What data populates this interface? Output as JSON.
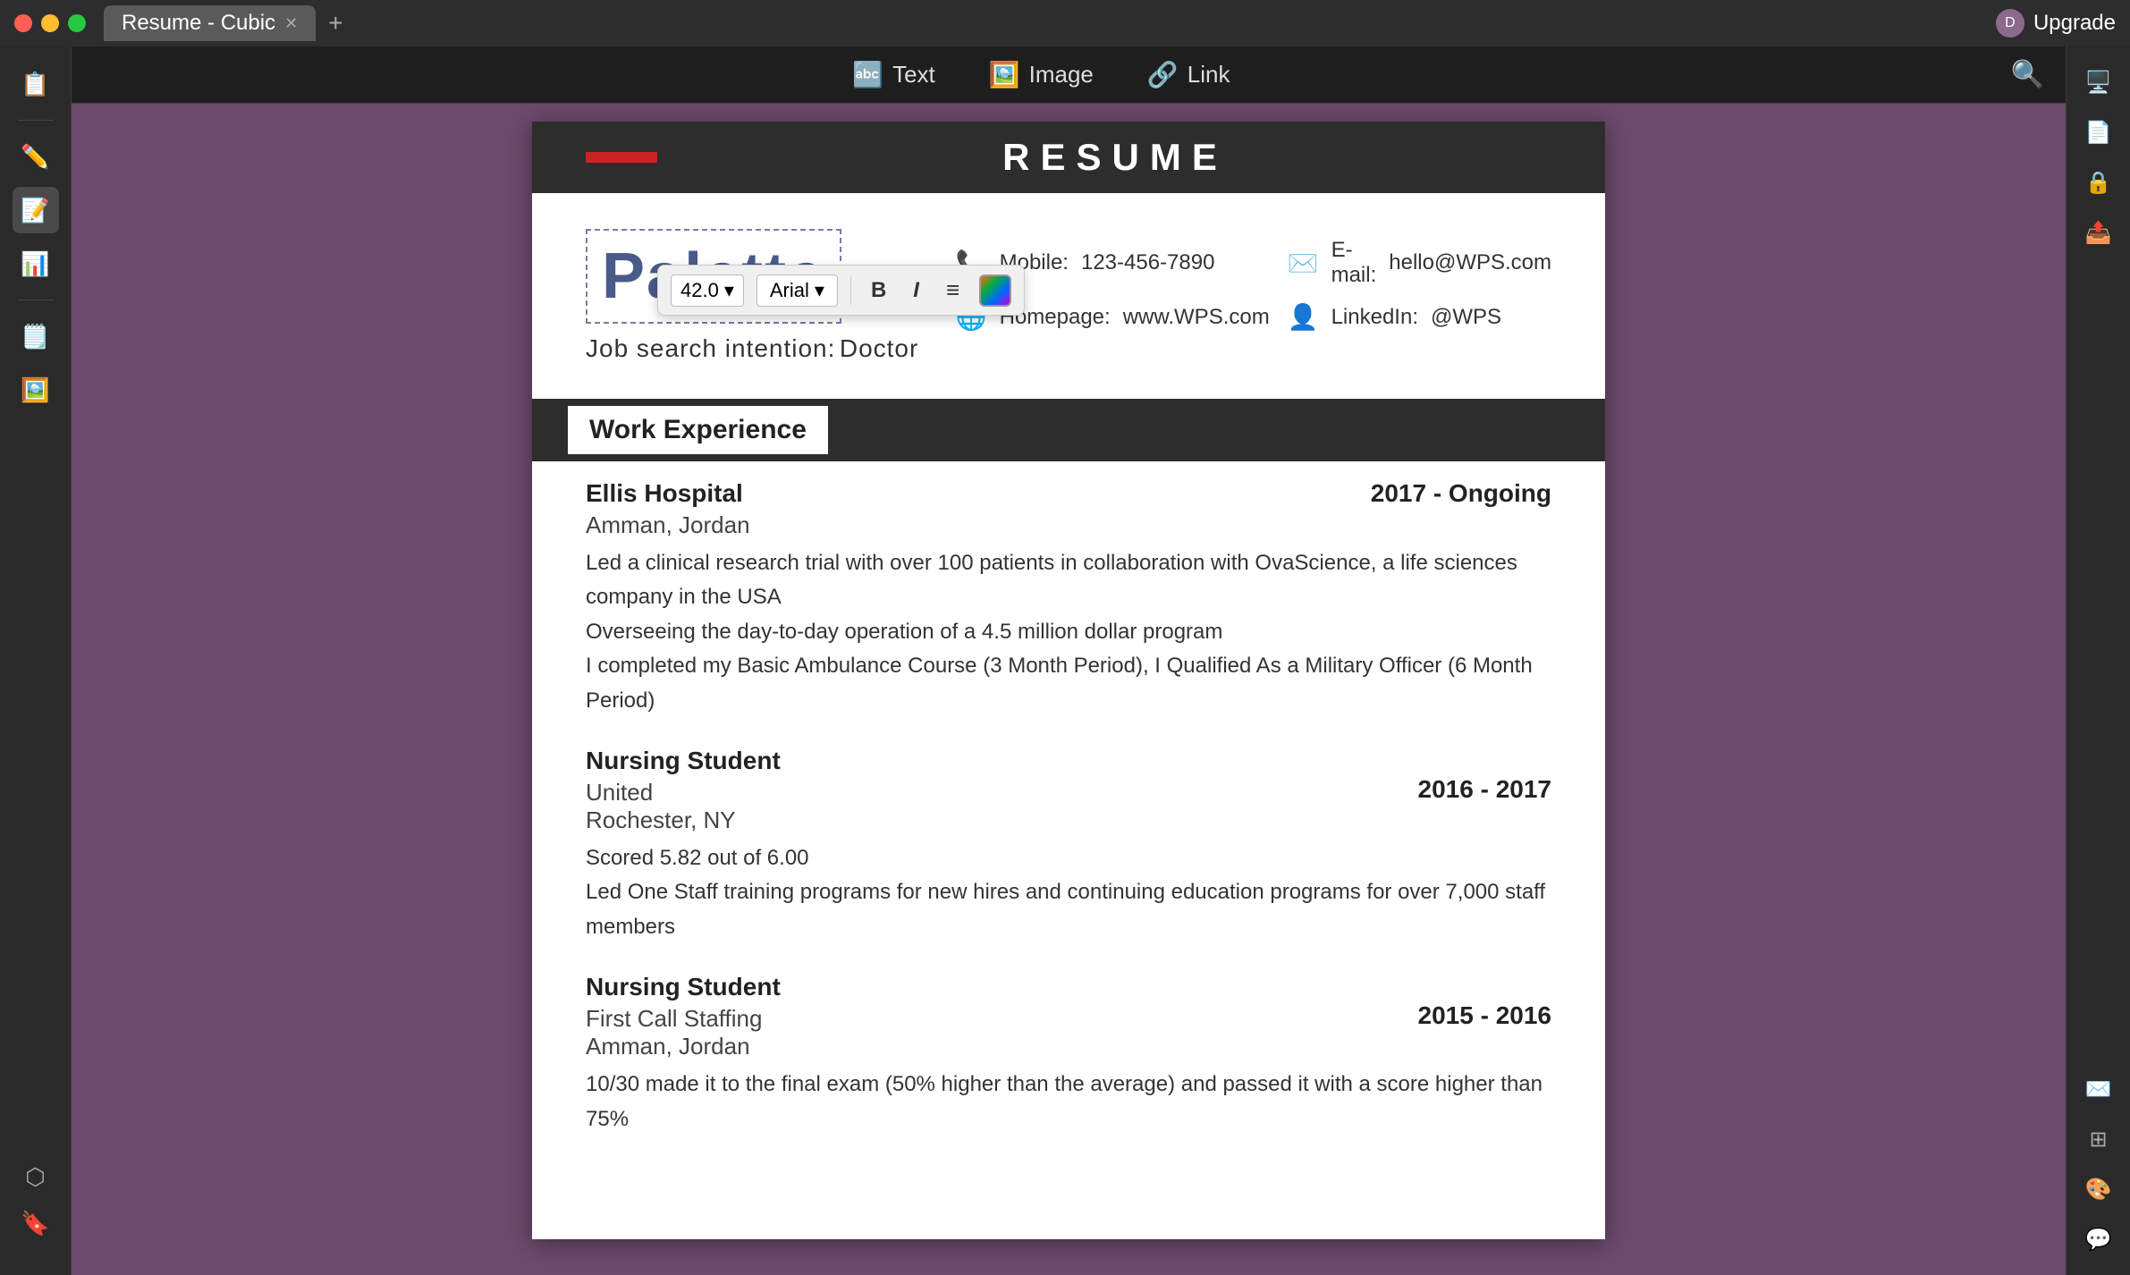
{
  "titlebar": {
    "tab_label": "Resume - Cubic",
    "upgrade_label": "Upgrade",
    "upgrade_avatar": "D"
  },
  "toolbar": {
    "text_label": "Text",
    "image_label": "Image",
    "link_label": "Link"
  },
  "floating_toolbar": {
    "font_size": "42.0",
    "font_name": "Arial",
    "bold_label": "B",
    "italic_label": "I",
    "list_label": "≡"
  },
  "sidebar_left": {
    "icons": [
      "📋",
      "✏️",
      "📝",
      "📊",
      "📋",
      "🖼️"
    ]
  },
  "sidebar_right": {
    "icons": [
      "🖥️",
      "📄",
      "🔒",
      "📤",
      "✉️",
      "🔲",
      "🎨",
      "💬"
    ]
  },
  "resume": {
    "header_title": "RESUME",
    "name": "Palette",
    "job_intention_label": "Job search intention:",
    "job_intention_value": "Doctor",
    "contact": {
      "mobile_label": "Mobile:",
      "mobile_value": "123-456-7890",
      "email_label": "E-mail:",
      "email_value": "hello@WPS.com",
      "homepage_label": "Homepage:",
      "homepage_value": "www.WPS.com",
      "linkedin_label": "LinkedIn:",
      "linkedin_value": "@WPS"
    },
    "work_experience": {
      "section_title": "Work Experience",
      "jobs": [
        {
          "company": "Ellis Hospital",
          "dates": "2017 - Ongoing",
          "location1": "Amman,  Jordan",
          "bullets": [
            "Led a  clinical research trial with over 100 patients in collaboration with OvaScience, a life sciences company in the USA",
            "Overseeing the day-to-day operation of a 4.5 million dollar program",
            "I completed my Basic Ambulance Course (3 Month Period), I Qualified As a Military Officer (6 Month Period)"
          ]
        },
        {
          "company": "Nursing Student",
          "company2": "United",
          "dates": "2016 - 2017",
          "location1": "Rochester, NY",
          "bullets": [
            "Scored 5.82 out of 6.00",
            "Led  One  Staff  training  programs  for  new hires and continuing education programs for over 7,000 staff members"
          ]
        },
        {
          "company": "Nursing Student",
          "company2": "First Call Staffing",
          "dates": "2015 - 2016",
          "location1": "Amman,  Jordan",
          "bullets": [
            "10/30  made it to the final exam (50% higher than the average) and passed it with a score  higher than 75%"
          ]
        }
      ]
    }
  }
}
